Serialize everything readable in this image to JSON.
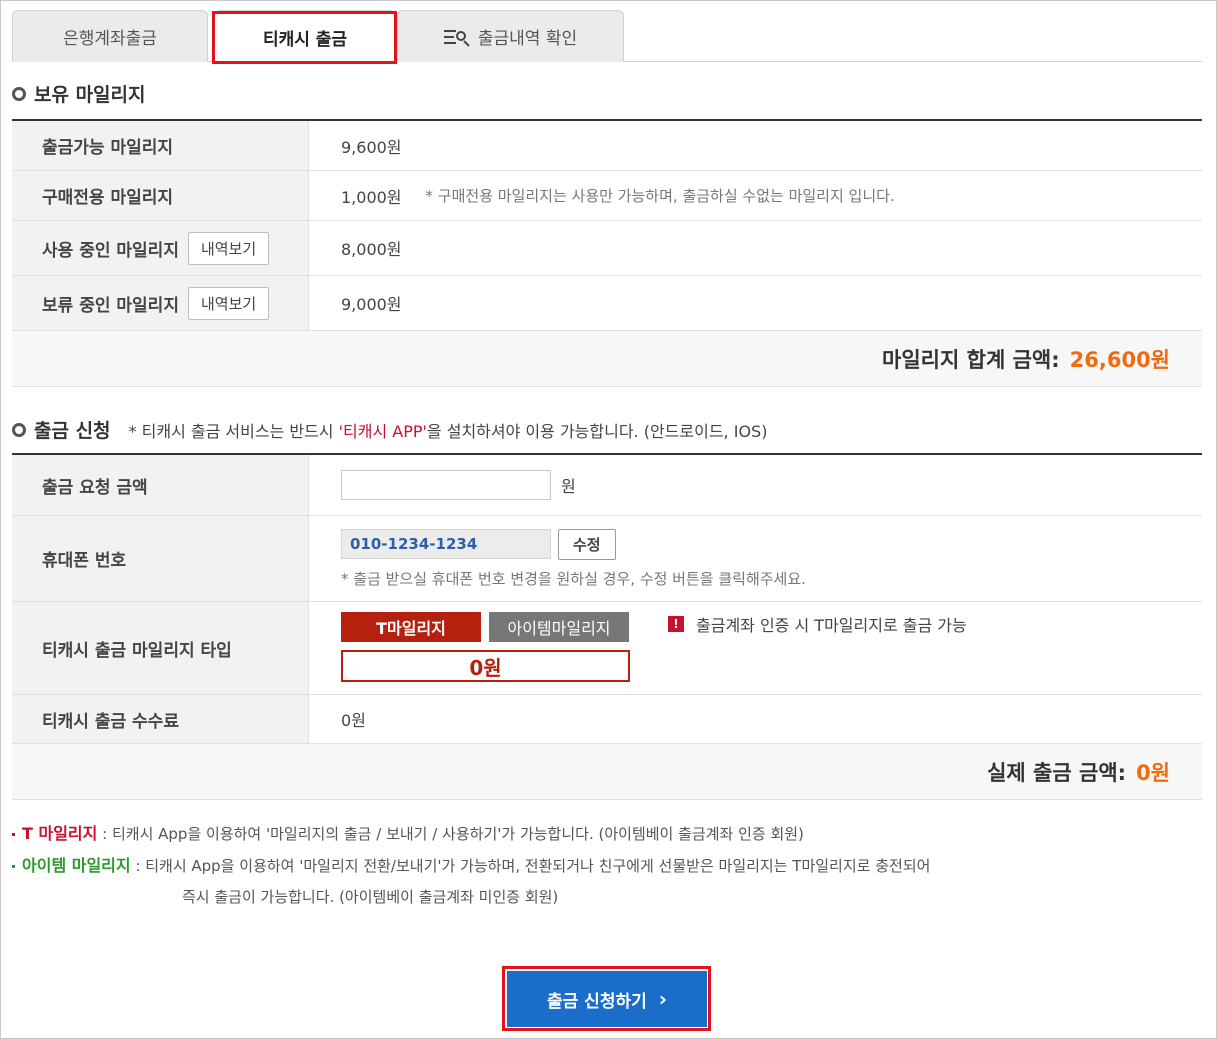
{
  "tabs": [
    {
      "label": "은행계좌출금"
    },
    {
      "label": "티캐시 출금"
    },
    {
      "label": "출금내역 확인"
    }
  ],
  "holdings": {
    "title": "보유 마일리지",
    "rows": [
      {
        "label": "출금가능 마일리지",
        "value": "9,600원"
      },
      {
        "label": "구매전용 마일리지",
        "value": "1,000원",
        "note": "* 구매전용 마일리지는 사용만 가능하며, 출금하실 수없는 마일리지 입니다."
      },
      {
        "label": "사용 중인 마일리지",
        "button": "내역보기",
        "value": "8,000원"
      },
      {
        "label": "보류 중인 마일리지",
        "button": "내역보기",
        "value": "9,000원"
      }
    ],
    "total_label": "마일리지 합계 금액:",
    "total_value": "26,600원"
  },
  "request": {
    "title": "출금 신청",
    "note_prefix": "* 티캐시 출금 서비스는 반드시 ",
    "note_app": "'티캐시 APP'",
    "note_suffix": "을 설치하셔야 이용 가능합니다. (안드로이드, IOS)",
    "amount_label": "출금 요청 금액",
    "amount_value": "",
    "amount_unit": "원",
    "phone_label": "휴대폰 번호",
    "phone_value": "010-1234-1234",
    "phone_edit": "수정",
    "phone_note": "* 출금 받으실 휴대폰 번호 변경을 원하실 경우, 수정 버튼을 클릭해주세요.",
    "type_label": "티캐시 출금 마일리지 타입",
    "type_t": "T마일리지",
    "type_item": "아이템마일리지",
    "type_amount": "0원",
    "type_warning": "출금계좌 인증 시 T마일리지로 출금 가능",
    "fee_label": "티캐시 출금 수수료",
    "fee_value": "0원",
    "actual_label": "실제 출금 금액:",
    "actual_value": "0원"
  },
  "legend": {
    "t_label": "T 마일리지",
    "t_text": ": 티캐시 App을 이용하여 '마일리지의 출금 / 보내기 / 사용하기'가 가능합니다. (아이템베이 출금계좌 인증 회원)",
    "i_label": "아이템 마일리지",
    "i_text": ": 티캐시 App을 이용하여 '마일리지 전환/보내기'가 가능하며, 전환되거나 친구에게 선물받은 마일리지는 T마일리지로 충전되어",
    "i_text2": "즉시 출금이 가능합니다. (아이템베이 출금계좌 미인증 회원)"
  },
  "apply_button": "출금 신청하기",
  "apply_arrow": "›",
  "warning_glyph": "!",
  "colors": {
    "accent_orange": "#f26a10",
    "brand_red": "#b5200f",
    "button_blue": "#1a6ec9",
    "highlight_red": "#e5121d"
  }
}
